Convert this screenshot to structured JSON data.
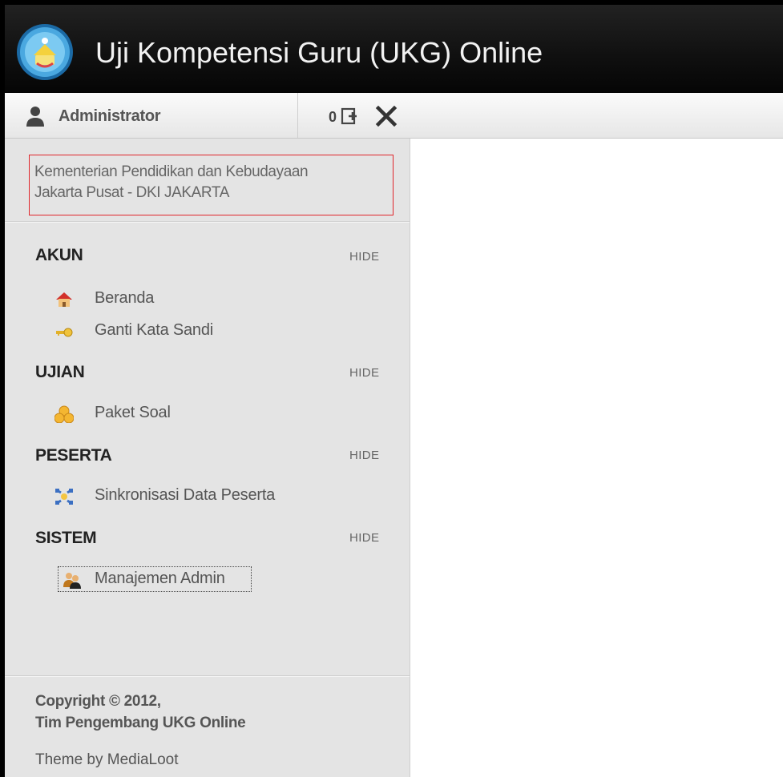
{
  "app": {
    "title": "Uji Kompetensi Guru (UKG) Online"
  },
  "toolbar": {
    "user_name": "Administrator",
    "message_count": "0"
  },
  "sidebar": {
    "org_line1": "Kementerian Pendidikan dan Kebudayaan",
    "org_line2": "Jakarta Pusat - DKI JAKARTA",
    "hide_label": "HIDE",
    "sections": [
      {
        "title": "AKUN",
        "items": [
          {
            "label": "Beranda",
            "icon": "home-icon"
          },
          {
            "label": "Ganti Kata Sandi",
            "icon": "key-icon"
          }
        ]
      },
      {
        "title": "UJIAN",
        "items": [
          {
            "label": "Paket Soal",
            "icon": "package-icon"
          }
        ]
      },
      {
        "title": "PESERTA",
        "items": [
          {
            "label": "Sinkronisasi Data Peserta",
            "icon": "sync-icon"
          }
        ]
      },
      {
        "title": "SISTEM",
        "items": [
          {
            "label": "Manajemen Admin",
            "icon": "admin-users-icon"
          }
        ]
      }
    ],
    "footer": {
      "copyright_line1": "Copyright © 2012,",
      "copyright_line2": "Tim Pengembang UKG Online",
      "theme_credit": "Theme by MediaLoot"
    }
  },
  "colors": {
    "header_bg": "#111111",
    "sidebar_bg": "#e4e4e4",
    "highlight_border": "#e0262b"
  }
}
